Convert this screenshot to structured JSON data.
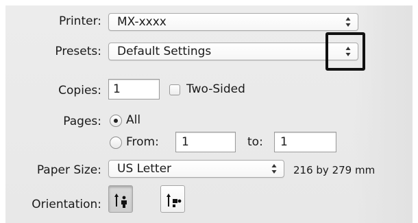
{
  "printer": {
    "label": "Printer:",
    "value": "MX-xxxx"
  },
  "presets": {
    "label": "Presets:",
    "value": "Default Settings"
  },
  "copies": {
    "label": "Copies:",
    "value": "1",
    "two_sided_label": "Two-Sided",
    "two_sided_checked": false
  },
  "pages": {
    "label": "Pages:",
    "all_label": "All",
    "from_label": "From:",
    "from_value": "1",
    "to_label": "to:",
    "to_value": "1",
    "selected": "All"
  },
  "paper_size": {
    "label": "Paper Size:",
    "value": "US Letter",
    "dimensions": "216 by 279 mm"
  },
  "orientation": {
    "label": "Orientation:",
    "options": [
      {
        "icon": "portrait-orientation-icon",
        "selected": true
      },
      {
        "icon": "landscape-orientation-icon",
        "selected": false
      }
    ]
  },
  "colors": {
    "panel": "#ececec",
    "highlight_border": "#111111"
  }
}
